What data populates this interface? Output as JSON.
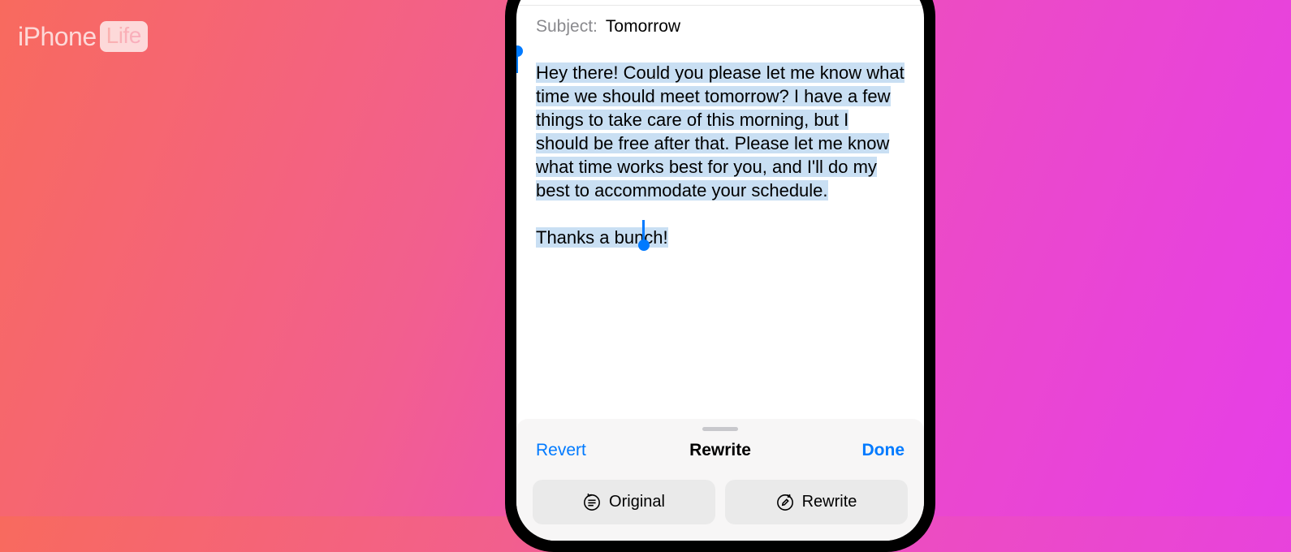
{
  "watermark": {
    "prefix": "iPhone",
    "suffix": "Life"
  },
  "email": {
    "subject_label": "Subject:",
    "subject_value": "Tomorrow",
    "body_p1": "Hey there! Could you please let me know what time we should meet tomorrow? I have a few things to take care of this morning, but I should be free after that. Please let me know what time works best for you, and I'll do my best to accommodate your schedule.",
    "body_p2": "Thanks a bunch!"
  },
  "toolbar": {
    "revert_label": "Revert",
    "title": "Rewrite",
    "done_label": "Done",
    "original_label": "Original",
    "rewrite_label": "Rewrite"
  }
}
